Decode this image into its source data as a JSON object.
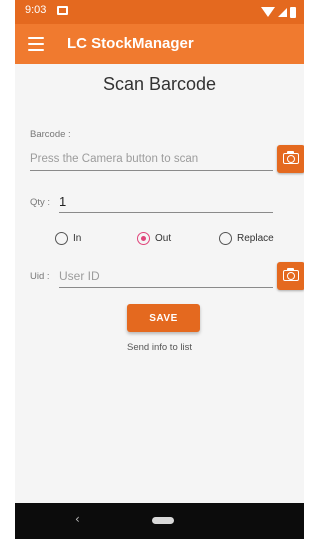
{
  "status_bar": {
    "time": "9:03"
  },
  "app_bar": {
    "title": "LC StockManager"
  },
  "page": {
    "title": "Scan Barcode"
  },
  "barcode": {
    "label": "Barcode :",
    "placeholder": "Press the Camera button to scan",
    "value": ""
  },
  "qty": {
    "label": "Qty :",
    "value": "1"
  },
  "mode": {
    "options": [
      {
        "label": "In",
        "checked": false
      },
      {
        "label": "Out",
        "checked": true
      },
      {
        "label": "Replace",
        "checked": false
      }
    ]
  },
  "uid": {
    "label": "Uid :",
    "placeholder": "User ID",
    "value": ""
  },
  "save": {
    "label": "SAVE",
    "helper": "Send info to list"
  },
  "nav": {
    "back_glyph": "‹"
  },
  "colors": {
    "accent": "#e4691f",
    "appbar": "#f07a2f",
    "radio_checked": "#e0457b"
  }
}
